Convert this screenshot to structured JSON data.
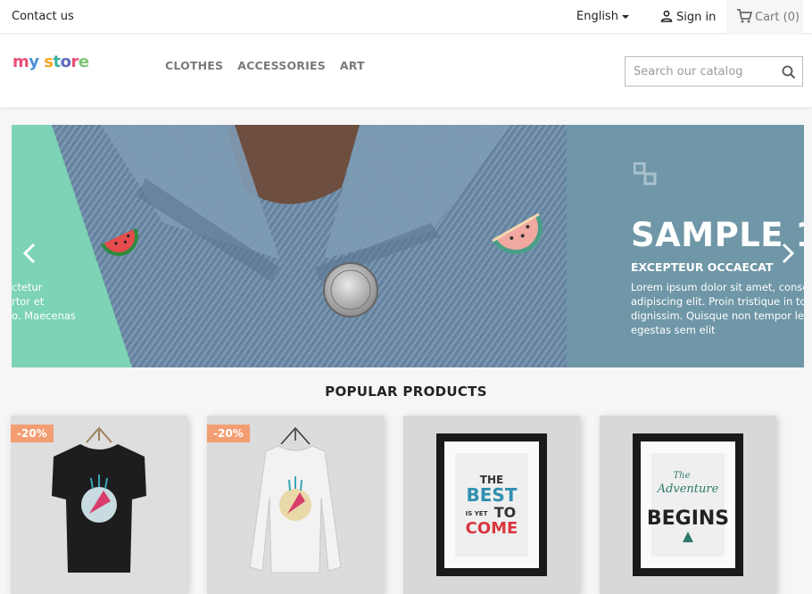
{
  "topbar": {
    "contact_label": "Contact us",
    "language_label": "English",
    "signin_label": "Sign in",
    "cart_label": "Cart",
    "cart_count": "(0)"
  },
  "header": {
    "logo_parts": [
      "m",
      "y",
      " ",
      "s",
      "t",
      "o",
      "r",
      "e"
    ],
    "nav": [
      "CLOTHES",
      "ACCESSORIES",
      "ART"
    ],
    "search_placeholder": "Search our catalog"
  },
  "slider": {
    "prev_text_lines": [
      "ctetur",
      "rtor et",
      "o. Maecenas"
    ],
    "title": "SAMPLE 1",
    "subtitle": "EXCEPTEUR OCCAECAT",
    "text_lines": [
      "Lorem ipsum dolor sit amet, conse",
      "adipiscing elit. Proin tristique in to",
      "dignissim. Quisque non tempor lec",
      "egestas sem elit"
    ]
  },
  "popular": {
    "title": "POPULAR PRODUCTS",
    "products": [
      {
        "badge": "-20%",
        "kind": "tshirt-black"
      },
      {
        "badge": "-20%",
        "kind": "sweater-white"
      },
      {
        "badge": "",
        "kind": "poster-best",
        "poster_lines": [
          "THE",
          "BEST",
          "IS YET",
          "TO",
          "COME"
        ]
      },
      {
        "badge": "",
        "kind": "poster-adventure",
        "poster_lines": [
          "The",
          "Adventure",
          "BEGINS"
        ]
      }
    ]
  },
  "colors": {
    "logo": [
      "#e94e77",
      "#4a90d9",
      "#f5a623",
      "#3bb0a0",
      "#5b6abf",
      "#e94e77",
      "#7cc576"
    ],
    "badge": "#f39d72",
    "slide_panel": "#6f97a7",
    "slide_green": "#7dd3b5"
  }
}
